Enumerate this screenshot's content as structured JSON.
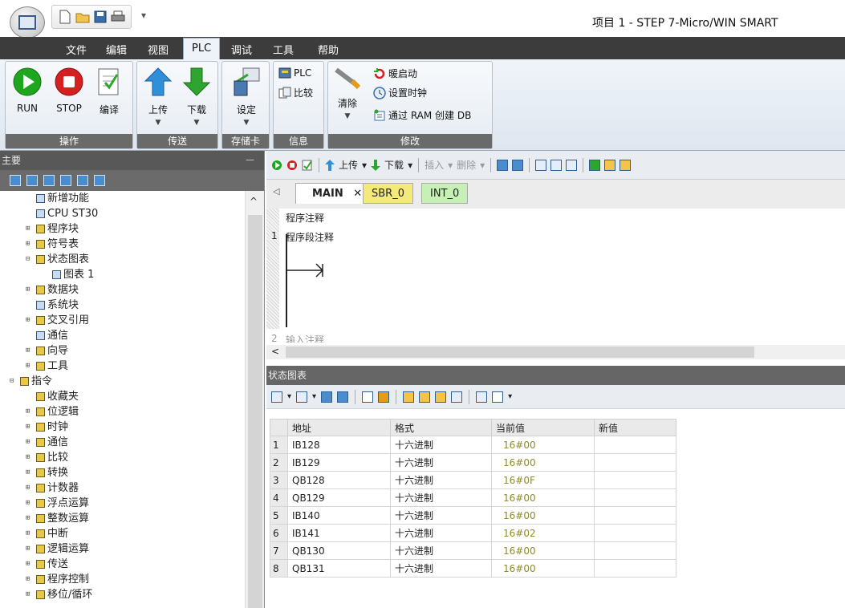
{
  "window": {
    "title": "项目 1 - STEP 7-Micro/WIN SMART",
    "qat_dropdown": "▾"
  },
  "menu": {
    "items": [
      "文件",
      "编辑",
      "视图",
      "PLC",
      "调试",
      "工具",
      "帮助"
    ],
    "active": "PLC"
  },
  "ribbon": {
    "groups": {
      "ops": "操作",
      "transfer": "传送",
      "card": "存储卡",
      "info": "信息",
      "modify": "修改"
    },
    "buttons": {
      "run": "RUN",
      "stop": "STOP",
      "compile": "编译",
      "upload": "上传",
      "download": "下载",
      "setup": "设定",
      "plc": "PLC",
      "compare": "比较",
      "clear": "清除",
      "warm_start": "暖启动",
      "set_clock": "设置时钟",
      "create_db": "通过 RAM 创建 DB"
    }
  },
  "left_panel": {
    "title": "主要",
    "pin": "ꟷ",
    "tree": [
      {
        "label": "新增功能",
        "exp": "",
        "indent": 1
      },
      {
        "label": "CPU ST30",
        "exp": "",
        "indent": 1
      },
      {
        "label": "程序块",
        "exp": "⊞",
        "indent": 1
      },
      {
        "label": "符号表",
        "exp": "⊞",
        "indent": 1
      },
      {
        "label": "状态图表",
        "exp": "⊟",
        "indent": 1
      },
      {
        "label": "图表 1",
        "exp": "",
        "indent": 2
      },
      {
        "label": "数据块",
        "exp": "⊞",
        "indent": 1
      },
      {
        "label": "系统块",
        "exp": "",
        "indent": 1
      },
      {
        "label": "交叉引用",
        "exp": "⊞",
        "indent": 1
      },
      {
        "label": "通信",
        "exp": "",
        "indent": 1
      },
      {
        "label": "向导",
        "exp": "⊞",
        "indent": 1
      },
      {
        "label": "工具",
        "exp": "⊞",
        "indent": 1
      },
      {
        "label": "指令",
        "exp": "⊟",
        "indent": 0
      },
      {
        "label": "收藏夹",
        "exp": "",
        "indent": 1
      },
      {
        "label": "位逻辑",
        "exp": "⊞",
        "indent": 1
      },
      {
        "label": "时钟",
        "exp": "⊞",
        "indent": 1
      },
      {
        "label": "通信",
        "exp": "⊞",
        "indent": 1
      },
      {
        "label": "比较",
        "exp": "⊞",
        "indent": 1
      },
      {
        "label": "转换",
        "exp": "⊞",
        "indent": 1
      },
      {
        "label": "计数器",
        "exp": "⊞",
        "indent": 1
      },
      {
        "label": "浮点运算",
        "exp": "⊞",
        "indent": 1
      },
      {
        "label": "整数运算",
        "exp": "⊞",
        "indent": 1
      },
      {
        "label": "中断",
        "exp": "⊞",
        "indent": 1
      },
      {
        "label": "逻辑运算",
        "exp": "⊞",
        "indent": 1
      },
      {
        "label": "传送",
        "exp": "⊞",
        "indent": 1
      },
      {
        "label": "程序控制",
        "exp": "⊞",
        "indent": 1
      },
      {
        "label": "移位/循环",
        "exp": "⊞",
        "indent": 1
      }
    ]
  },
  "editor": {
    "toolbar": {
      "upload": "上传",
      "download": "下载",
      "insert": "插入",
      "delete": "删除"
    },
    "tabs": [
      "MAIN",
      "SBR_0",
      "INT_0"
    ],
    "program_comment": "程序注释",
    "network_number": "1",
    "network_comment": "程序段注释",
    "network2_number": "2",
    "network2_comment": "输入注释"
  },
  "status_chart": {
    "title": "状态图表",
    "columns": [
      "地址",
      "格式",
      "当前值",
      "新值"
    ],
    "rows": [
      {
        "idx": "1",
        "address": "IB128",
        "format": "十六进制",
        "current": "16#00",
        "new": ""
      },
      {
        "idx": "2",
        "address": "IB129",
        "format": "十六进制",
        "current": "16#00",
        "new": ""
      },
      {
        "idx": "3",
        "address": "QB128",
        "format": "十六进制",
        "current": "16#0F",
        "new": ""
      },
      {
        "idx": "4",
        "address": "QB129",
        "format": "十六进制",
        "current": "16#00",
        "new": ""
      },
      {
        "idx": "5",
        "address": "IB140",
        "format": "十六进制",
        "current": "16#00",
        "new": ""
      },
      {
        "idx": "6",
        "address": "IB141",
        "format": "十六进制",
        "current": "16#02",
        "new": ""
      },
      {
        "idx": "7",
        "address": "QB130",
        "format": "十六进制",
        "current": "16#00",
        "new": ""
      },
      {
        "idx": "8",
        "address": "QB131",
        "format": "十六进制",
        "current": "16#00",
        "new": ""
      }
    ]
  },
  "colors": {
    "run_green": "#1fa61f",
    "stop_red": "#d42020",
    "arrow_blue": "#2f8fd8",
    "arrow_green": "#2ea52e",
    "value_olive": "#8f8a2a"
  }
}
